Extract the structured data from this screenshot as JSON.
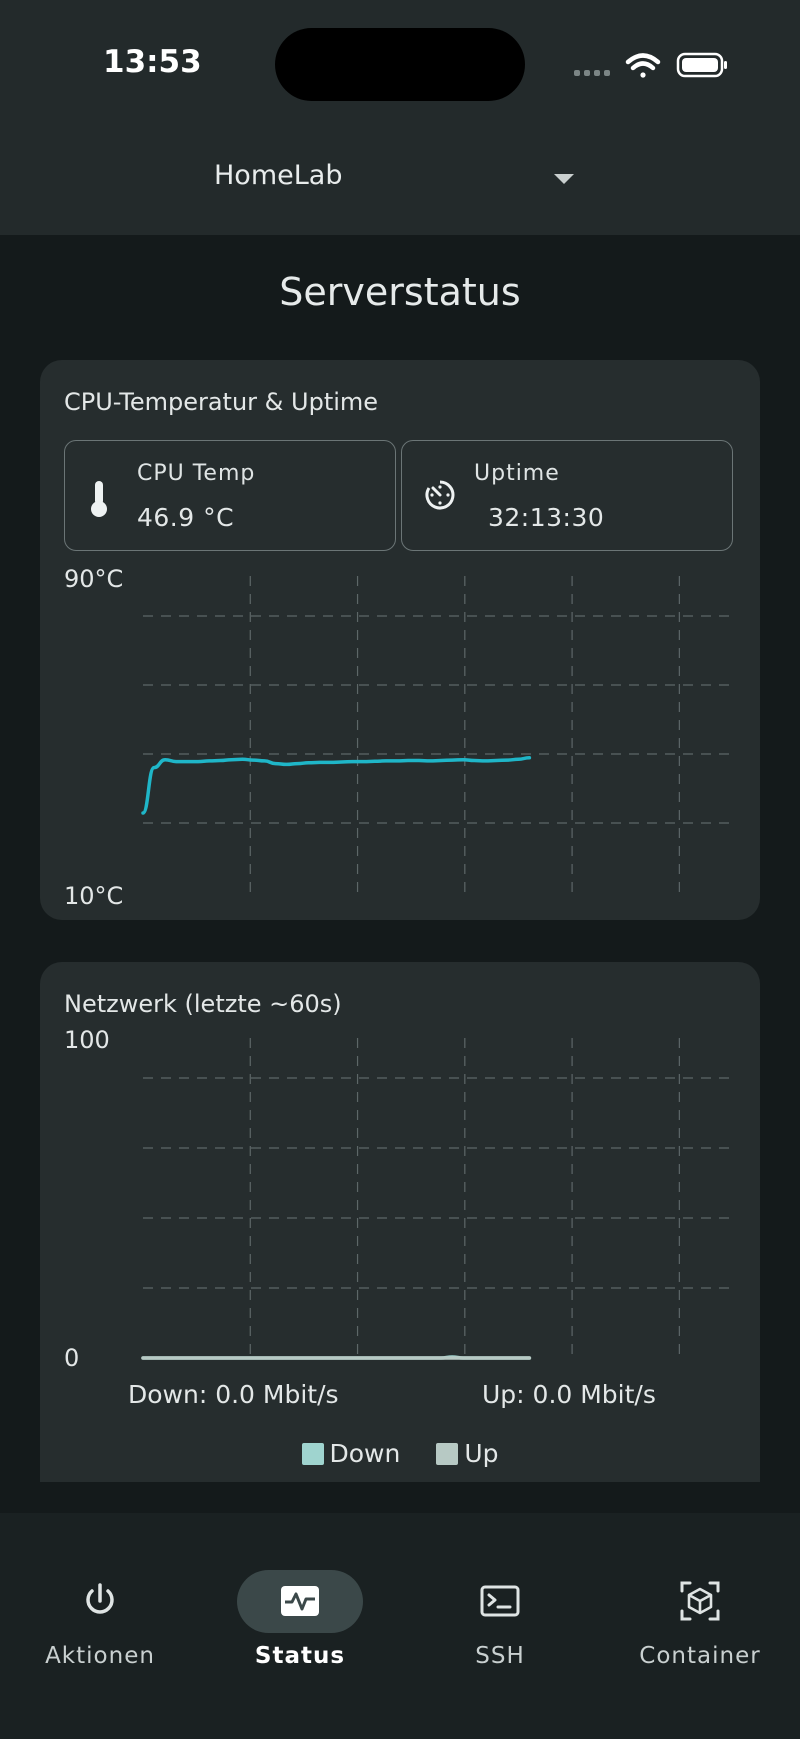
{
  "status_bar": {
    "time": "13:53"
  },
  "server_selector": {
    "selected": "HomeLab"
  },
  "page": {
    "title": "Serverstatus"
  },
  "cpu_card": {
    "title": "CPU-Temperatur & Uptime",
    "cpu_temp": {
      "label": "CPU Temp",
      "value": "46.9 °C",
      "icon": "thermometer-icon"
    },
    "uptime": {
      "label": "Uptime",
      "value": "32:13:30",
      "icon": "timer-icon"
    },
    "chart_data": {
      "type": "line",
      "ylim": [
        10,
        90
      ],
      "ymax_label": "90°C",
      "ymin_label": "10°C",
      "grid": true,
      "series": [
        {
          "color": "#1fb6c8",
          "values": [
            30,
            41.5,
            43.5,
            43,
            43,
            43,
            43.2,
            43.3,
            43.5,
            43.6,
            43.4,
            43.2,
            42.5,
            42.3,
            42.5,
            42.7,
            42.8,
            42.8,
            42.9,
            43,
            43,
            43.1,
            43.2,
            43.2,
            43.3,
            43.3,
            43.2,
            43.3,
            43.4,
            43.5,
            43.3,
            43.2,
            43.3,
            43.4,
            43.6,
            44
          ]
        }
      ]
    }
  },
  "network_card": {
    "title": "Netzwerk (letzte ~60s)",
    "down_readout": "Down: 0.0 Mbit/s",
    "up_readout": "Up: 0.0 Mbit/s",
    "chart_data": {
      "type": "area",
      "ylim": [
        0,
        100
      ],
      "ymax_label": "100",
      "ymin_label": "0",
      "grid": true,
      "series": [
        {
          "name": "Down",
          "color": "#9fd4cf",
          "values": [
            0,
            0,
            0,
            0,
            0,
            0,
            0,
            0,
            0,
            0,
            0,
            0,
            0,
            0,
            0,
            0,
            0,
            0,
            0,
            0,
            0,
            0,
            0,
            0,
            0,
            0,
            0,
            0,
            0.3,
            0,
            0,
            0,
            0,
            0,
            0,
            0
          ]
        },
        {
          "name": "Up",
          "color": "#b7c9c4",
          "values": [
            0,
            0,
            0,
            0,
            0,
            0,
            0,
            0,
            0,
            0,
            0,
            0,
            0,
            0,
            0,
            0,
            0,
            0,
            0,
            0,
            0,
            0,
            0,
            0,
            0,
            0,
            0,
            0,
            0,
            0,
            0,
            0,
            0,
            0,
            0,
            0
          ]
        }
      ],
      "legend": "bottom"
    }
  },
  "nav": {
    "items": [
      {
        "label": "Aktionen",
        "icon": "power-icon"
      },
      {
        "label": "Status",
        "icon": "activity-icon",
        "active": true
      },
      {
        "label": "SSH",
        "icon": "terminal-icon"
      },
      {
        "label": "Container",
        "icon": "container-icon"
      }
    ]
  },
  "colors": {
    "accent": "#1fb6c8",
    "card": "#262d2e",
    "background": "#141a1b"
  }
}
